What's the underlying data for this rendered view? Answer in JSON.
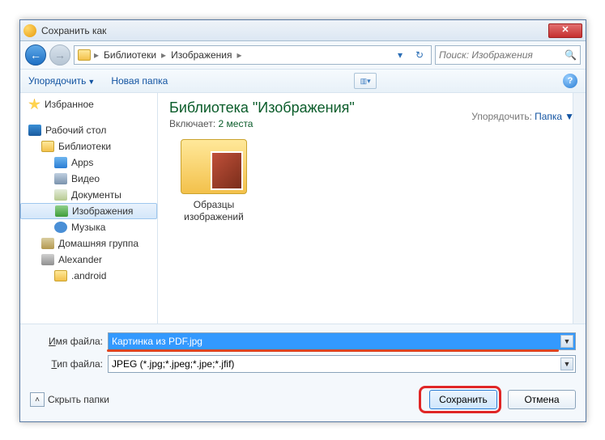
{
  "title": "Сохранить как",
  "breadcrumb": {
    "root_icon": "computer-icon",
    "items": [
      "Библиотеки",
      "Изображения"
    ]
  },
  "search": {
    "placeholder": "Поиск: Изображения"
  },
  "toolbar": {
    "organize": "Упорядочить",
    "newfolder": "Новая папка"
  },
  "sidebar": {
    "favorites": "Избранное",
    "desktop": "Рабочий стол",
    "libraries": "Библиотеки",
    "apps": "Apps",
    "video": "Видео",
    "documents": "Документы",
    "pictures": "Изображения",
    "music": "Музыка",
    "homegroup": "Домашняя группа",
    "user": "Alexander",
    "android": ".android"
  },
  "content": {
    "library_title": "Библиотека \"Изображения\"",
    "includes_label": "Включает:",
    "includes_value": "2 места",
    "arrange_label": "Упорядочить:",
    "arrange_value": "Папка",
    "folders": [
      {
        "name": "Образцы изображений"
      }
    ]
  },
  "filename": {
    "label": "Имя файла:",
    "value": "Картинка из PDF.jpg"
  },
  "filetype": {
    "label": "Тип файла:",
    "value": "JPEG (*.jpg;*.jpeg;*.jpe;*.jfif)"
  },
  "hide_folders": "Скрыть папки",
  "buttons": {
    "save": "Сохранить",
    "cancel": "Отмена"
  }
}
